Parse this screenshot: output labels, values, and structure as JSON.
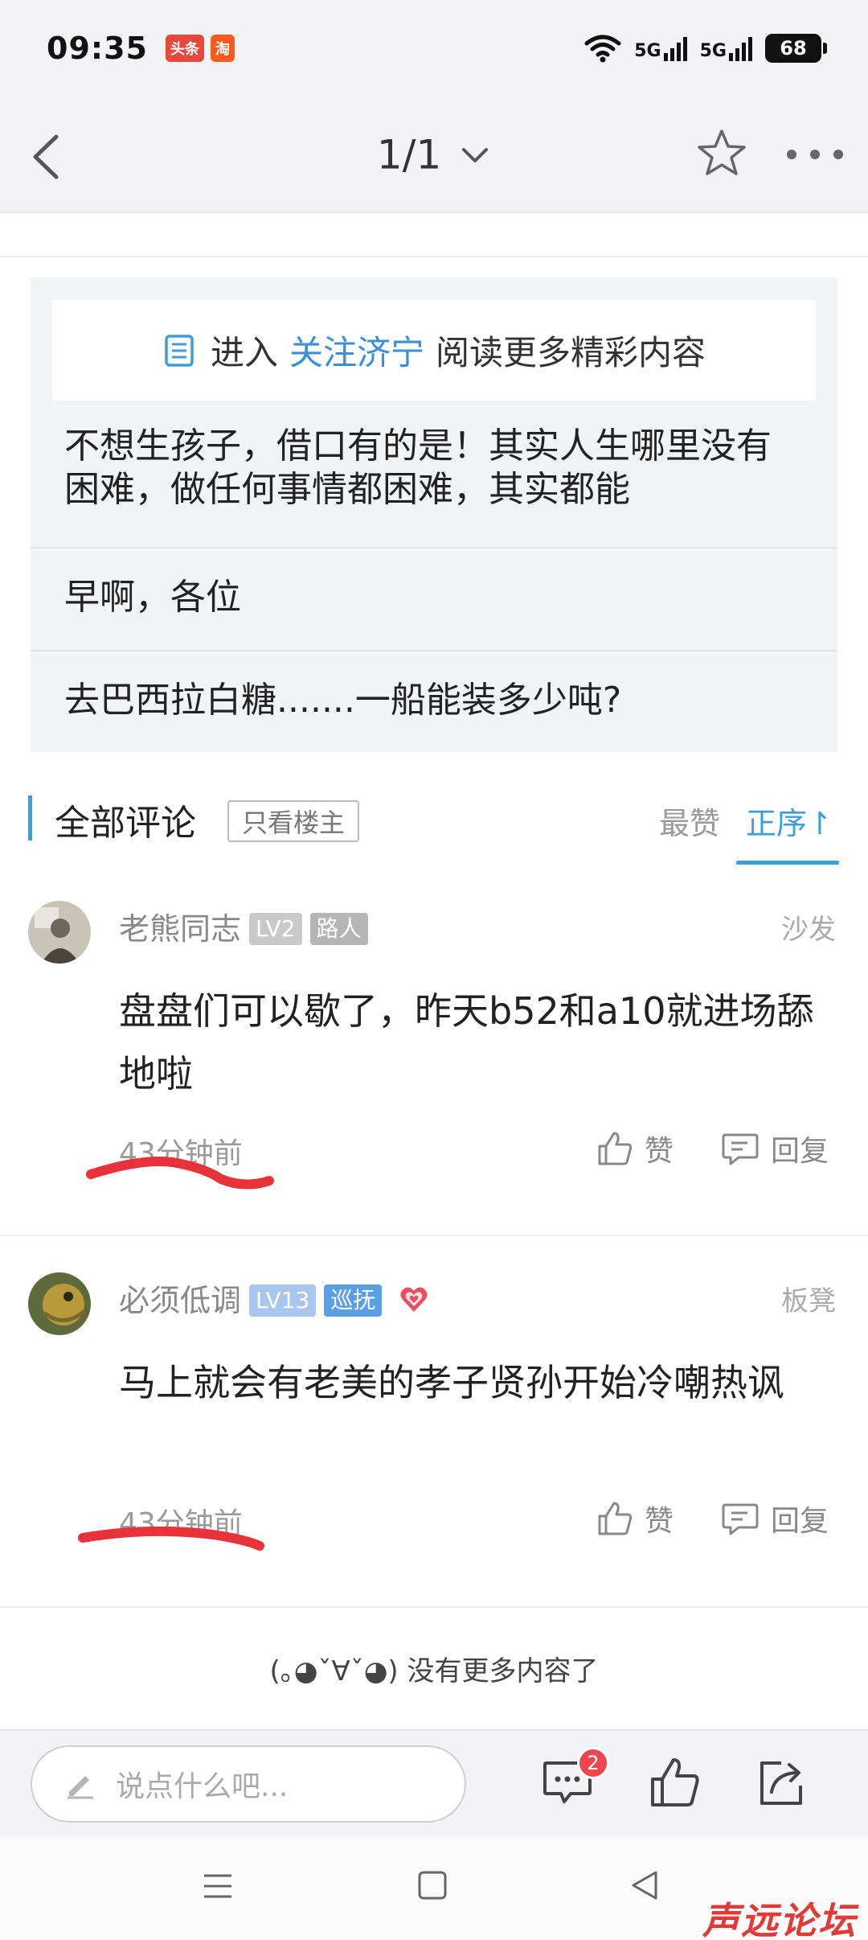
{
  "status_bar": {
    "time": "09:35",
    "app_icons": [
      {
        "name": "toutiao-app-icon",
        "label": "头条",
        "color": "#e8473c"
      },
      {
        "name": "taobao-app-icon",
        "label": "淘",
        "color": "#ff5a1f"
      }
    ],
    "signal_1": "5G",
    "signal_2": "5G",
    "battery": "68"
  },
  "nav": {
    "pager": "1/1",
    "icons": [
      "back-arrow-icon",
      "chevron-down-icon",
      "star-icon",
      "more-dots-icon"
    ]
  },
  "related": {
    "promo_prefix": "进入",
    "promo_link": "关注济宁",
    "promo_suffix": "阅读更多精彩内容",
    "items": [
      "不想生孩子，借口有的是！其实人生哪里没有困难，做任何事情都困难，其实都能",
      "早啊，各位",
      "去巴西拉白糖.......一船能装多少吨?"
    ]
  },
  "comments_header": {
    "title": "全部评论",
    "op_only": "只看楼主",
    "sort_hot": "最赞",
    "sort_asc": "正序↾",
    "accent_color": "#3b9fdc"
  },
  "comments": [
    {
      "author": "老熊同志",
      "level": "LV2",
      "role": "路人",
      "floor": "沙发",
      "text": "盘盘们可以歇了，昨天b52和a10就进场舔地啦",
      "time": "43分钟前",
      "like": "赞",
      "reply": "回复"
    },
    {
      "author": "必须低调",
      "level": "LV13",
      "role": "巡抚",
      "floor": "板凳",
      "text": "马上就会有老美的孝子贤孙开始冷嘲热讽",
      "time": "43分钟前",
      "like": "赞",
      "reply": "回复"
    }
  ],
  "end_message": "(｡◕ˇ∀ˇ◕) 没有更多内容了",
  "bottom_bar": {
    "input_placeholder": "说点什么吧...",
    "message_count": "2",
    "icons": [
      "pencil-icon",
      "message-icon",
      "thumbs-up-icon",
      "share-icon"
    ]
  },
  "watermark": "声远论坛"
}
